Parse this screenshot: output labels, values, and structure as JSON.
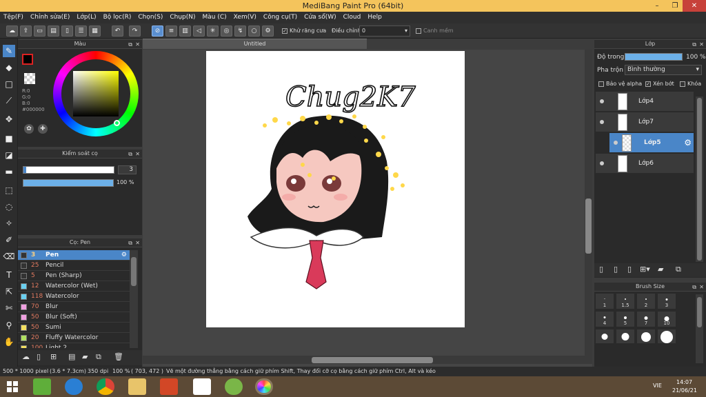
{
  "window": {
    "title": "MediBang Paint Pro (64bit)"
  },
  "menu": [
    "Tệp(F)",
    "Chỉnh sửa(E)",
    "Lớp(L)",
    "Bộ lọc(R)",
    "Chọn(S)",
    "Chụp(N)",
    "Màu (C)",
    "Xem(V)",
    "Công cụ(T)",
    "Cửa sổ(W)",
    "Cloud",
    "Help"
  ],
  "toolbar": {
    "antialias_label": "Khử răng cưa",
    "correction_label": "Điều chỉnh",
    "correction_value": "0",
    "snap_label": "Canh mềm"
  },
  "color_panel": {
    "title": "Màu",
    "rgb_r": "R:0",
    "rgb_g": "G:0",
    "rgb_b": "B:0",
    "hex": "#000000",
    "primary_color": "#000000"
  },
  "brush_control": {
    "title": "Kiểm soát cọ",
    "size": "3",
    "opacity": "100 %"
  },
  "brush_panel": {
    "title": "Cọ: Pen",
    "brushes": [
      {
        "size": "3",
        "name": "Pen",
        "color": "#333333"
      },
      {
        "size": "25",
        "name": "Pencil",
        "color": "#333333"
      },
      {
        "size": "5",
        "name": "Pen (Sharp)",
        "color": "#333333"
      },
      {
        "size": "12",
        "name": "Watercolor (Wet)",
        "color": "#6ad0f0"
      },
      {
        "size": "118",
        "name": "Watercolor",
        "color": "#6ad0f0"
      },
      {
        "size": "70",
        "name": "Blur",
        "color": "#f0a0e0"
      },
      {
        "size": "50",
        "name": "Blur (Soft)",
        "color": "#f0a0e0"
      },
      {
        "size": "50",
        "name": "Sumi",
        "color": "#f4e060"
      },
      {
        "size": "20",
        "name": "Fluffy Watercolor",
        "color": "#b0e060"
      },
      {
        "size": "100",
        "name": "Light 2",
        "color": "#f4e060"
      }
    ]
  },
  "canvas": {
    "tab_title": "Untitled",
    "signature": "Chug2K7"
  },
  "layer_panel": {
    "title": "Lớp",
    "opacity_label": "Độ trong",
    "opacity_value": "100 %",
    "blend_label": "Pha trộn",
    "blend_value": "Bình thường",
    "protect_alpha": "Bảo vệ alpha",
    "clipping": "Xén bớt",
    "lock": "Khóa",
    "layers": [
      "Lớp4",
      "Lớp7",
      "Lớp5",
      "Lớp6"
    ]
  },
  "brush_size_panel": {
    "title": "Brush Size",
    "sizes": [
      "1",
      "1.5",
      "2",
      "3",
      "4",
      "5",
      "7",
      "10"
    ]
  },
  "status": {
    "dimensions": "500 * 1000 pixel",
    "physical": "(3.6 * 7.3cm)",
    "dpi": "350 dpi",
    "zoom": "100 %",
    "coords": "( 703, 472 )",
    "hint": "Vẽ một đường thẳng bằng cách giữ phím Shift, Thay đổi cỡ cọ bằng cách giữ phím Ctrl, Alt và kéo"
  },
  "taskbar": {
    "lang": "VIE",
    "time": "14:07",
    "date": "21/06/21"
  }
}
